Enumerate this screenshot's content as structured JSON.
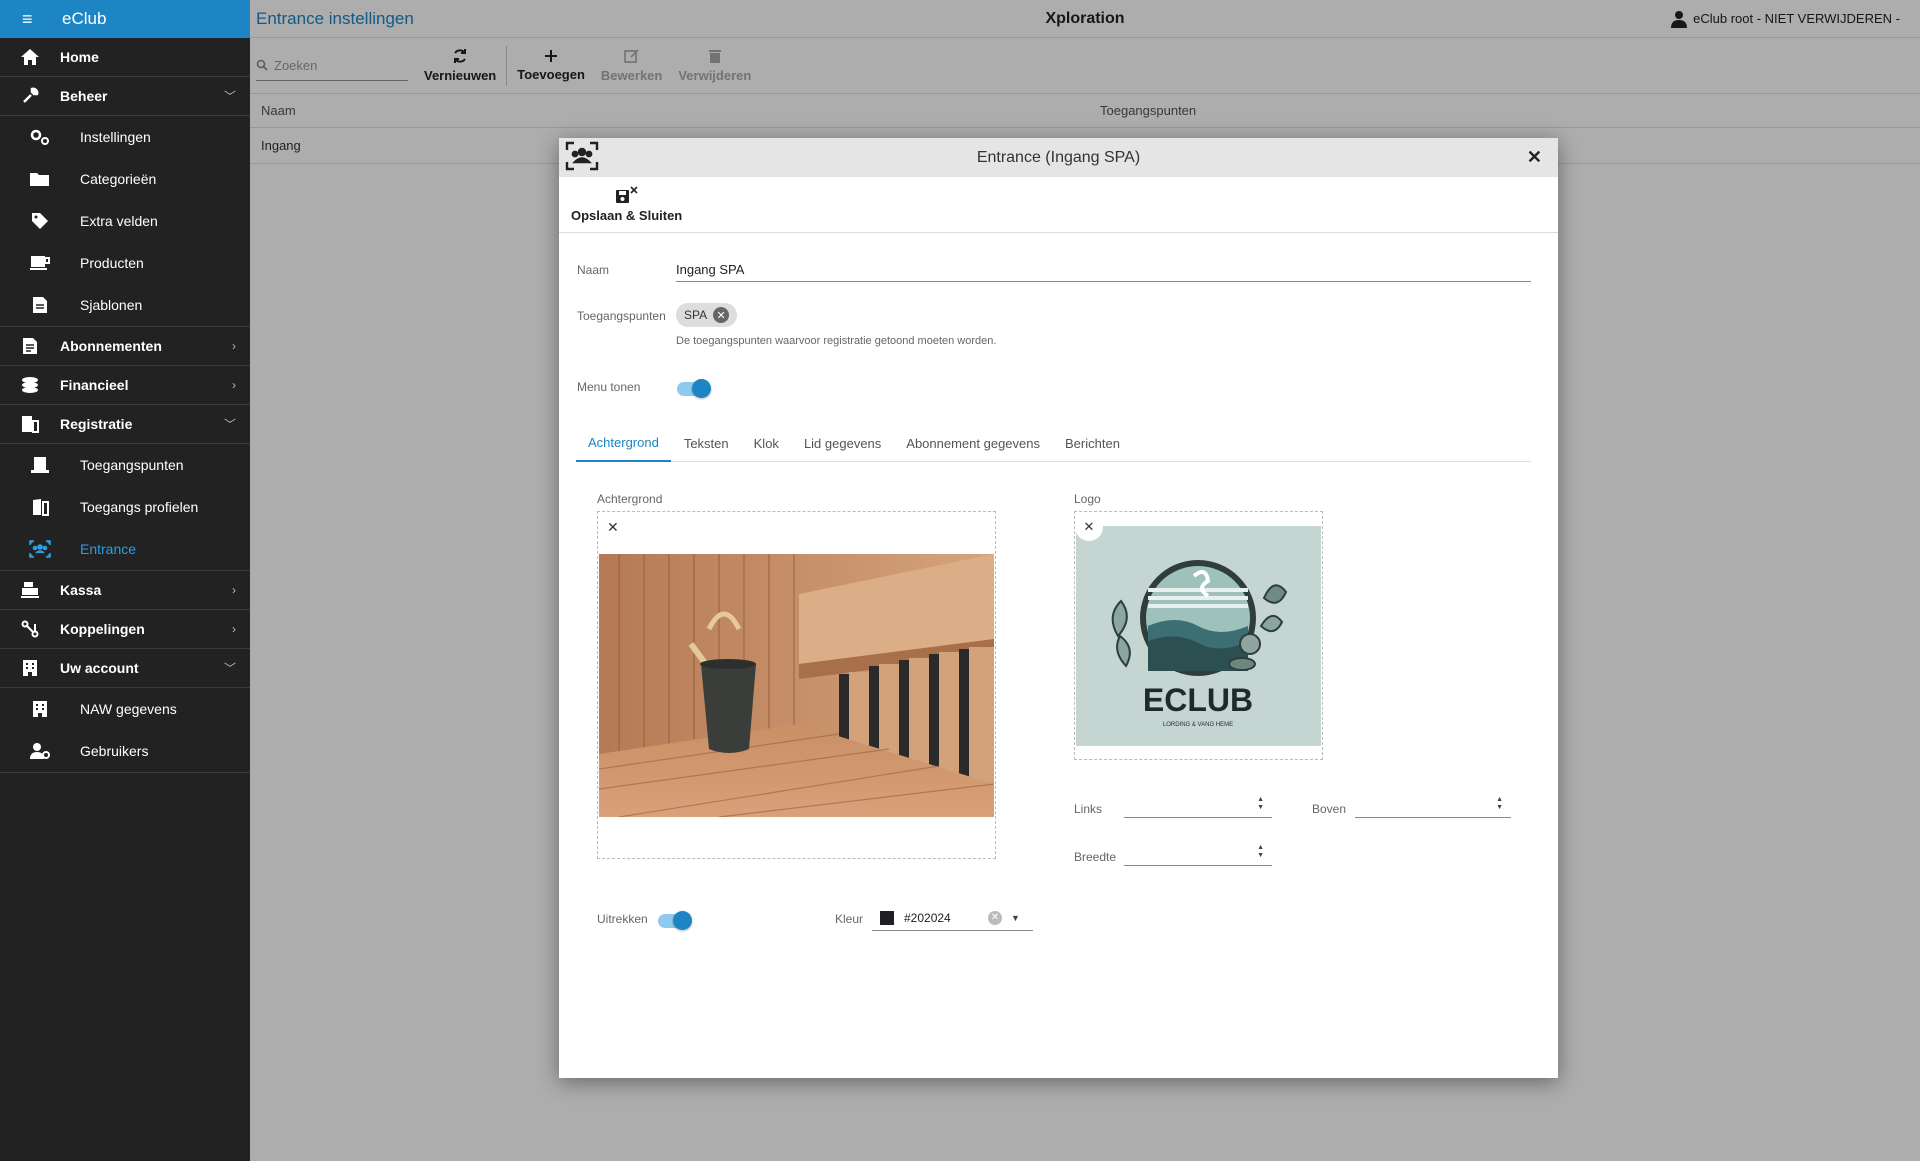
{
  "app": {
    "brand": "eClub"
  },
  "sidebar": {
    "items": [
      {
        "label": "Home",
        "icon": "home-icon",
        "type": "top"
      },
      {
        "label": "Beheer",
        "icon": "wrench-icon",
        "type": "top",
        "chevron": "down"
      },
      {
        "label": "Instellingen",
        "icon": "gears-icon",
        "type": "sub"
      },
      {
        "label": "Categorieën",
        "icon": "folder-icon",
        "type": "sub"
      },
      {
        "label": "Extra velden",
        "icon": "tag-icon",
        "type": "sub"
      },
      {
        "label": "Producten",
        "icon": "cup-icon",
        "type": "sub"
      },
      {
        "label": "Sjablonen",
        "icon": "document-icon",
        "type": "sub"
      },
      {
        "label": "Abonnementen",
        "icon": "file-icon",
        "type": "top",
        "chevron": "right"
      },
      {
        "label": "Financieel",
        "icon": "coins-icon",
        "type": "top",
        "chevron": "right"
      },
      {
        "label": "Registratie",
        "icon": "door-icon",
        "type": "top",
        "chevron": "down"
      },
      {
        "label": "Toegangspunten",
        "icon": "entry-icon",
        "type": "sub"
      },
      {
        "label": "Toegangs profielen",
        "icon": "door-open-icon",
        "type": "sub"
      },
      {
        "label": "Entrance",
        "icon": "people-scan-icon",
        "type": "sub",
        "active": true
      },
      {
        "label": "Kassa",
        "icon": "register-icon",
        "type": "top",
        "chevron": "right"
      },
      {
        "label": "Koppelingen",
        "icon": "connect-icon",
        "type": "top",
        "chevron": "right"
      },
      {
        "label": "Uw account",
        "icon": "building-icon",
        "type": "top",
        "chevron": "down"
      },
      {
        "label": "NAW gegevens",
        "icon": "building-icon",
        "type": "sub"
      },
      {
        "label": "Gebruikers",
        "icon": "user-gear-icon",
        "type": "sub"
      }
    ]
  },
  "header": {
    "title": "Entrance instellingen",
    "center": "Xploration",
    "user": "eClub root - NIET VERWIJDEREN -"
  },
  "toolbar": {
    "search_placeholder": "Zoeken",
    "refresh": "Vernieuwen",
    "add": "Toevoegen",
    "edit": "Bewerken",
    "delete": "Verwijderen"
  },
  "table": {
    "columns": [
      "Naam",
      "Toegangspunten"
    ],
    "rows": [
      {
        "naam": "Ingang",
        "toegangspunten": ""
      }
    ]
  },
  "dialog": {
    "title": "Entrance (Ingang SPA)",
    "save_close": "Opslaan & Sluiten",
    "naam_label": "Naam",
    "naam_value": "Ingang SPA",
    "toegang_label": "Toegangspunten",
    "toegang_chip": "SPA",
    "toegang_hint": "De toegangspunten waarvoor registratie getoond moeten worden.",
    "menu_label": "Menu tonen",
    "menu_on": true,
    "tabs": [
      "Achtergrond",
      "Teksten",
      "Klok",
      "Lid gegevens",
      "Abonnement gegevens",
      "Berichten"
    ],
    "active_tab": "Achtergrond",
    "achtergrond_label": "Achtergrond",
    "logo_label": "Logo",
    "logo_text": "ECLUB",
    "logo_subtext": "LORDING & VANG HEME",
    "links_label": "Links",
    "boven_label": "Boven",
    "breedte_label": "Breedte",
    "uitrekken_label": "Uitrekken",
    "uitrekken_on": true,
    "kleur_label": "Kleur",
    "kleur_value": "#202024"
  },
  "colors": {
    "accent": "#1d85c4",
    "sidebar_bg": "#222222",
    "swatch": "#202024"
  }
}
